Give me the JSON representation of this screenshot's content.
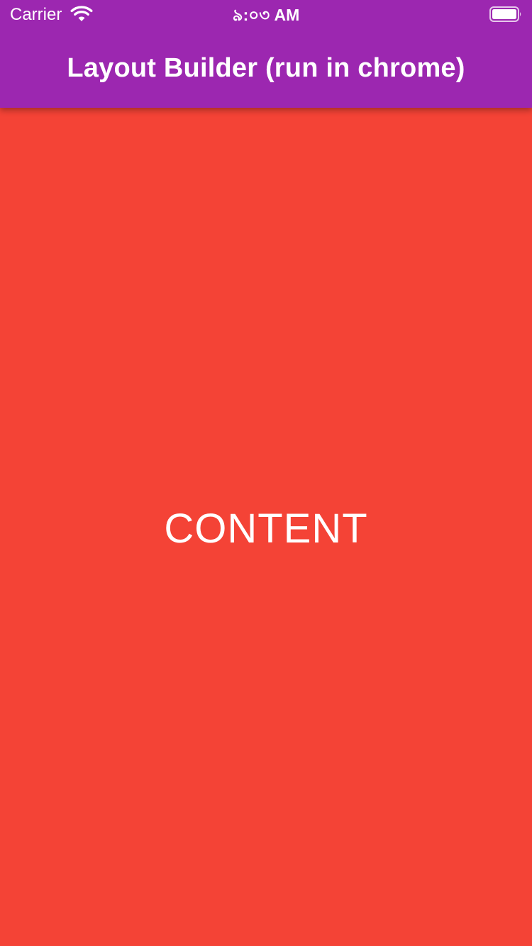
{
  "status_bar": {
    "carrier": "Carrier",
    "time": "৯:০৩ AM",
    "wifi_icon": "wifi-icon",
    "battery_icon": "battery-icon"
  },
  "app_bar": {
    "title": "Layout Builder (run in chrome)",
    "color": "#9c27b0"
  },
  "body": {
    "label": "CONTENT",
    "background_color": "#f44336"
  }
}
